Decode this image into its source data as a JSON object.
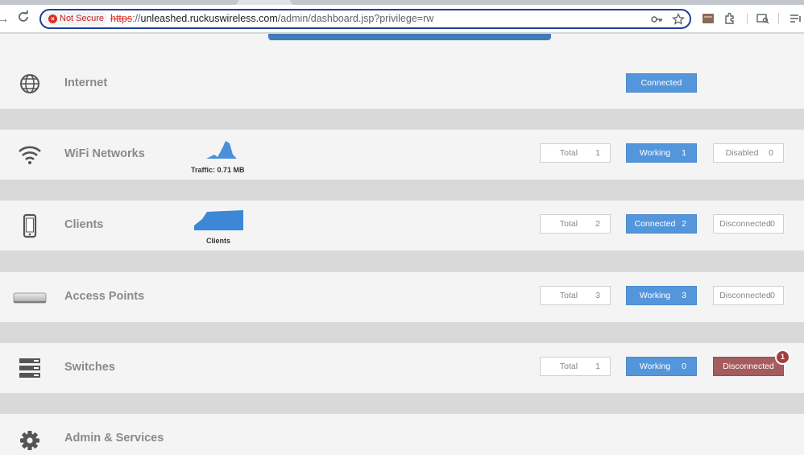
{
  "browser": {
    "security_label": "Not Secure",
    "url_scheme": "https",
    "url_sep": "://",
    "url_host": "unleashed.ruckuswireless.com",
    "url_path": "/admin/dashboard.jsp?privilege=rw"
  },
  "rows": {
    "internet": {
      "title": "Internet",
      "status": "Connected"
    },
    "wifi": {
      "title": "WiFi Networks",
      "chart_caption": "Traffic: 0.71 MB",
      "total_label": "Total",
      "total_value": "1",
      "working_label": "Working",
      "working_value": "1",
      "disabled_label": "Disabled",
      "disabled_value": "0"
    },
    "clients": {
      "title": "Clients",
      "chart_caption": "Clients",
      "total_label": "Total",
      "total_value": "2",
      "connected_label": "Connected",
      "connected_value": "2",
      "disconnected_label": "Disconnected",
      "disconnected_value": "0"
    },
    "aps": {
      "title": "Access Points",
      "total_label": "Total",
      "total_value": "3",
      "working_label": "Working",
      "working_value": "3",
      "disconnected_label": "Disconnected",
      "disconnected_value": "0"
    },
    "switches": {
      "title": "Switches",
      "total_label": "Total",
      "total_value": "1",
      "working_label": "Working",
      "working_value": "0",
      "disconnected_label": "Disconnected",
      "alert_count": "1"
    },
    "admin": {
      "title": "Admin & Services"
    }
  },
  "colors": {
    "accent": "#5496db",
    "danger": "#a45c5c",
    "title_gray": "#8a8a8a"
  }
}
